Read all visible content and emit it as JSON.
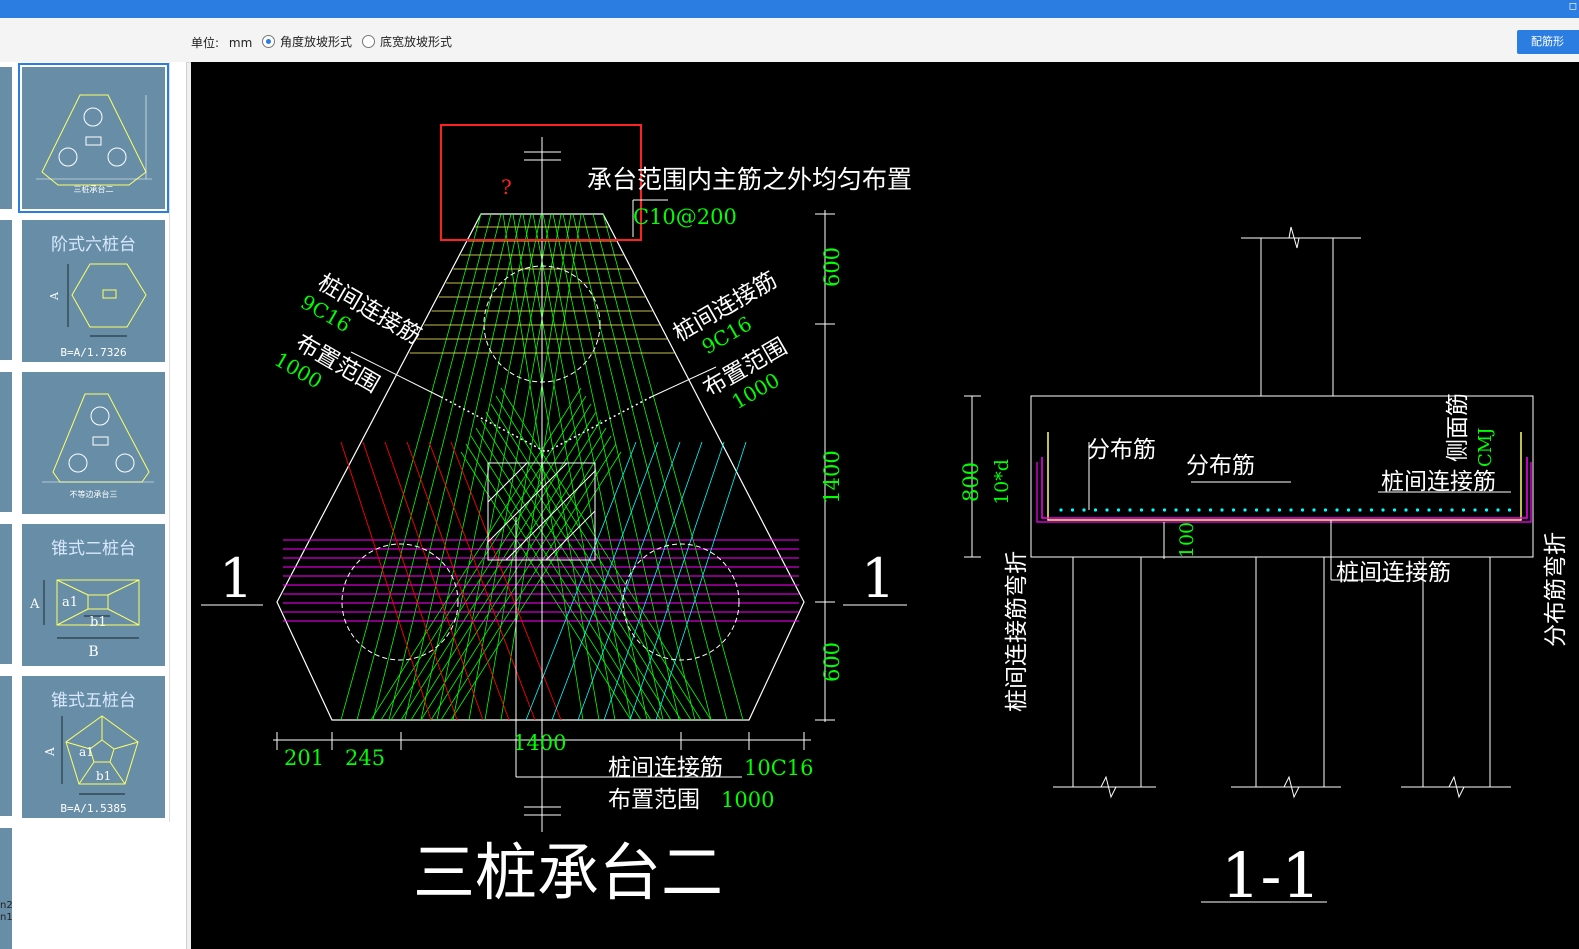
{
  "toolbar": {
    "unit_label": "单位:",
    "unit_value": "mm",
    "radio_angle": "角度放坡形式",
    "radio_width": "底宽放坡形式",
    "rebar_button": "配筋形"
  },
  "thumbnails": [
    {
      "title": "",
      "caption": "三桩承台二",
      "selected": true
    },
    {
      "title": "阶式六桩台",
      "caption": "B=A/1.7326"
    },
    {
      "title": "",
      "caption": "不等边承台三"
    },
    {
      "title": "锥式二桩台",
      "caption": "B"
    },
    {
      "title": "锥式五桩台",
      "caption": "B=A/1.5385"
    }
  ],
  "thumb_labels": {
    "A": "A",
    "a1": "a1",
    "b1": "b1"
  },
  "edge_text": "n2\nn1",
  "drawing": {
    "title_plan": "三桩承台二",
    "title_section": "1-1",
    "question_mark": "?",
    "note_top": "承台范围内主筋之外均匀布置",
    "note_top_rebar": "C10@200",
    "left_label_1": "桩间连接筋",
    "left_label_1_rebar": "9C16",
    "left_label_2": "布置范围",
    "left_label_2_value": "1000",
    "right_label_1": "桩间连接筋",
    "right_label_1_rebar": "9C16",
    "right_label_2": "布置范围",
    "right_label_2_value": "1000",
    "bottom_label_1": "桩间连接筋",
    "bottom_label_1_rebar": "10C16",
    "bottom_label_2": "布置范围",
    "bottom_label_2_value": "1000",
    "section_mark": "1",
    "dim_600_top": "600",
    "dim_1400_right": "1400",
    "dim_600_bottom": "600",
    "dim_201": "201",
    "dim_245": "245",
    "dim_1400_bottom": "1400",
    "sec_dist_1": "分布筋",
    "sec_dist_2": "分布筋",
    "sec_side": "侧面筋",
    "sec_side_rebar": "CMJ",
    "sec_conn_right": "桩间连接筋",
    "sec_conn_bottom": "桩间连接筋",
    "sec_conn_bend": "桩间连接筋弯折",
    "sec_dist_bend": "分布筋弯折",
    "sec_800": "800",
    "sec_10d": "10*d",
    "sec_100": "100"
  },
  "colors": {
    "accent": "#2b7de1",
    "cad_green": "#00ff00",
    "cad_white": "#ffffff",
    "cad_yellow": "#ffff66",
    "cad_magenta": "#ff00ff",
    "cad_red": "#ff0000",
    "cad_cyan": "#00ffff",
    "highlight_red": "#ff2020",
    "thumb_bg": "#678ea6"
  }
}
